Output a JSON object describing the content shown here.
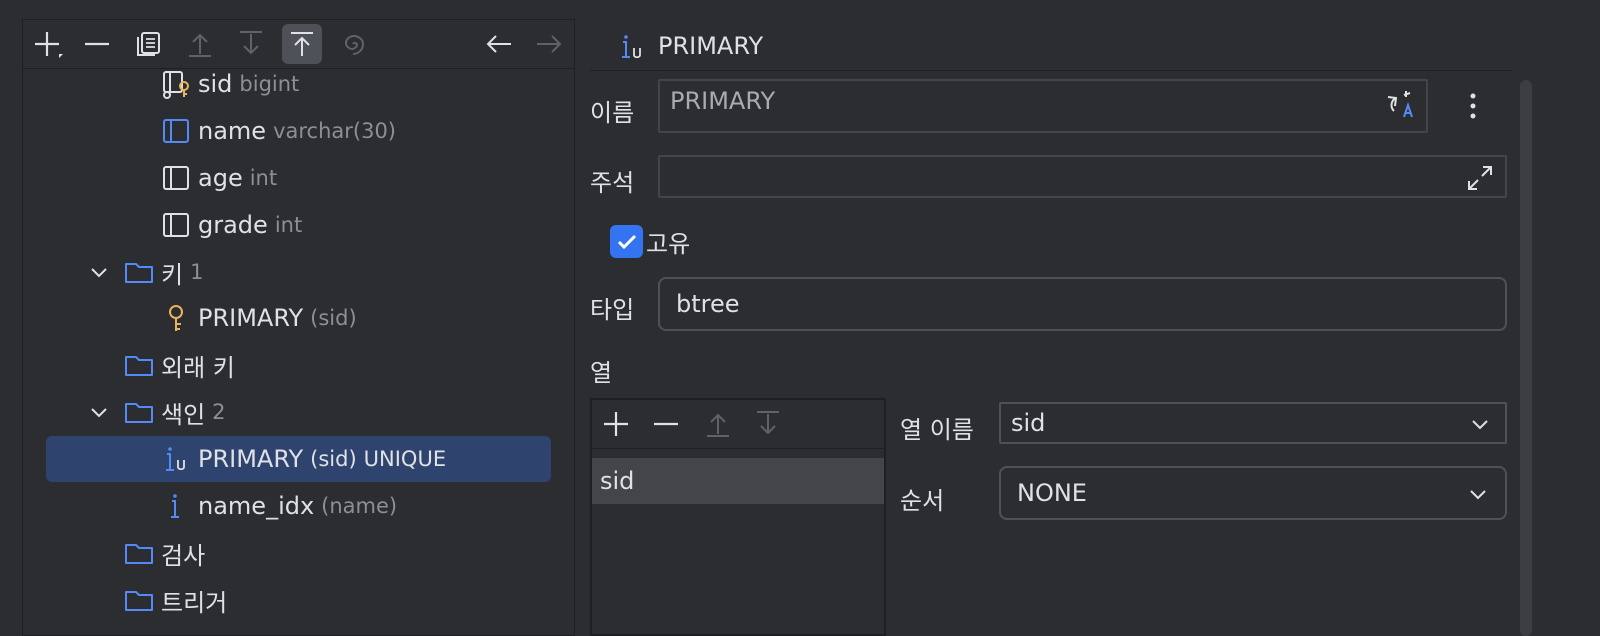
{
  "toolbar": {
    "buttons": [
      {
        "name": "add-icon"
      },
      {
        "name": "remove-icon"
      },
      {
        "name": "copy-icon"
      },
      {
        "name": "move-up-icon"
      },
      {
        "name": "move-down-icon"
      },
      {
        "name": "move-top-icon"
      },
      {
        "name": "spiral-icon"
      },
      {
        "name": "back-arrow-icon"
      },
      {
        "name": "forward-arrow-icon"
      }
    ]
  },
  "tree": {
    "items": [
      {
        "label": "sid",
        "hint": "bigint"
      },
      {
        "label": "name",
        "hint": "varchar(30)"
      },
      {
        "label": "age",
        "hint": "int"
      },
      {
        "label": "grade",
        "hint": "int"
      },
      {
        "label": "키",
        "hint": "1"
      },
      {
        "label": "PRIMARY",
        "hint": "(sid)"
      },
      {
        "label": "외래 키",
        "hint": ""
      },
      {
        "label": "색인",
        "hint": "2"
      },
      {
        "label": "PRIMARY",
        "hint": "(sid)",
        "extra": "UNIQUE"
      },
      {
        "label": "name_idx",
        "hint": "(name)"
      },
      {
        "label": "검사",
        "hint": ""
      },
      {
        "label": "트리거",
        "hint": ""
      }
    ]
  },
  "details": {
    "header_title": "PRIMARY",
    "name_label": "이름",
    "name_value": "PRIMARY",
    "comment_label": "주석",
    "comment_value": "",
    "unique_label": "고유",
    "unique_checked": true,
    "type_label": "타입",
    "type_value": "btree",
    "columns_label": "열",
    "columns": [
      "sid"
    ],
    "col_name_label": "열 이름",
    "col_name_value": "sid",
    "order_label": "순서",
    "order_value": "NONE"
  },
  "colors": {
    "accent": "#3574f0",
    "selection": "#2e436e",
    "folder": "#548af7",
    "key": "#e9b35c",
    "index": "#548af7"
  }
}
